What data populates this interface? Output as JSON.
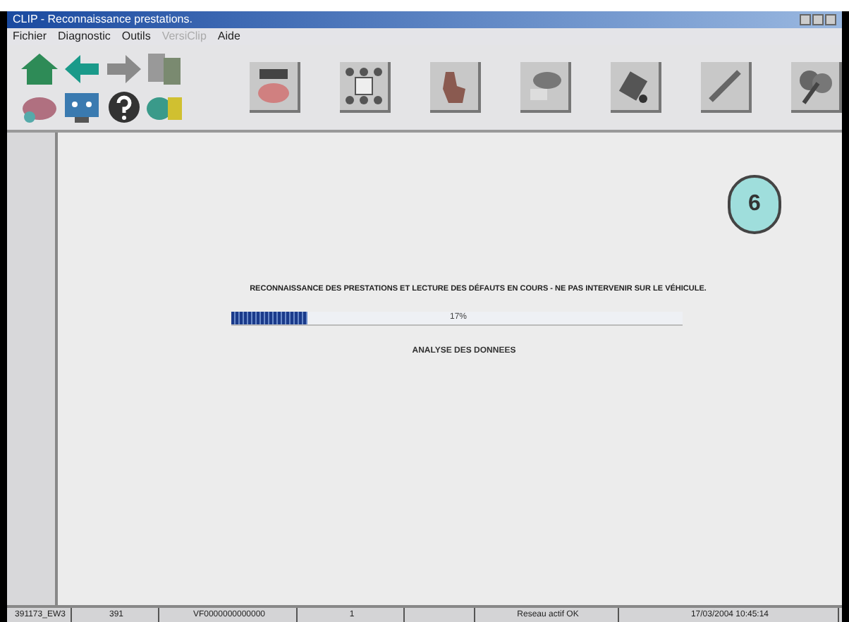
{
  "window": {
    "title": "CLIP - Reconnaissance prestations."
  },
  "menu": [
    {
      "label": "Fichier",
      "disabled": false
    },
    {
      "label": "Diagnostic",
      "disabled": false
    },
    {
      "label": "Outils",
      "disabled": false
    },
    {
      "label": "VersiClip",
      "disabled": true
    },
    {
      "label": "Aide",
      "disabled": false
    }
  ],
  "main": {
    "message": "RECONNAISSANCE DES PRESTATIONS ET LECTURE DES DÉFAUTS EN COURS - NE PAS INTERVENIR SUR LE VÉHICULE.",
    "progress": {
      "level": 0.17,
      "reading": "17%"
    },
    "status": "ANALYSE DES DONNEES"
  },
  "callout": "6",
  "status_bar": [
    {
      "text": "391173_EW3"
    },
    {
      "text": "391"
    },
    {
      "text": "VF0000000000000"
    },
    {
      "text": "1"
    },
    {
      "text": "Reseau actif OK"
    },
    {
      "text": "17/03/2004 10:45:14"
    }
  ]
}
